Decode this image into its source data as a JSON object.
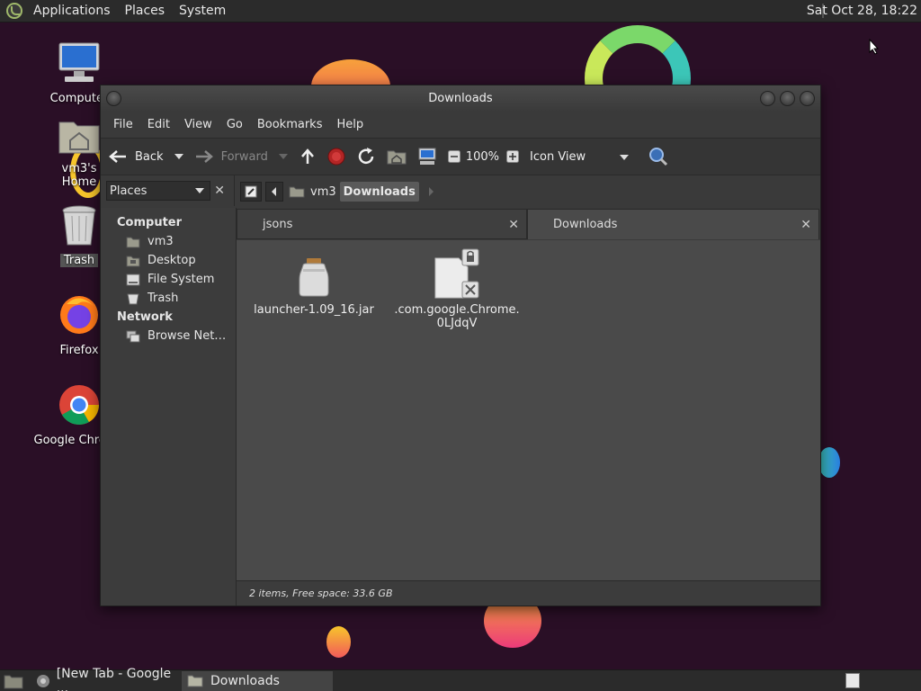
{
  "top_panel": {
    "menus": [
      "Applications",
      "Places",
      "System"
    ],
    "clock": "Sat Oct 28, 18:22"
  },
  "desktop_icons": [
    {
      "label": "Computer",
      "icon": "computer-icon"
    },
    {
      "label": "vm3's Home",
      "icon": "home-folder-icon"
    },
    {
      "label": "Trash",
      "icon": "trash-icon"
    },
    {
      "label": "Firefox",
      "icon": "firefox-icon"
    },
    {
      "label": "Google Chrome",
      "icon": "chrome-icon"
    }
  ],
  "window": {
    "title": "Downloads",
    "menu": [
      "File",
      "Edit",
      "View",
      "Go",
      "Bookmarks",
      "Help"
    ],
    "toolbar": {
      "back": "Back",
      "forward": "Forward",
      "zoom": "100%",
      "view_mode": "Icon View"
    },
    "places_label": "Places",
    "breadcrumb": [
      "vm3",
      "Downloads"
    ],
    "sidebar": {
      "computer_heading": "Computer",
      "computer_items": [
        "vm3",
        "Desktop",
        "File System",
        "Trash"
      ],
      "network_heading": "Network",
      "network_items": [
        "Browse Net…"
      ]
    },
    "tabs": [
      "jsons",
      "Downloads"
    ],
    "files": [
      {
        "name": "launcher-1.09_16.jar",
        "icon": "jar-icon"
      },
      {
        "name": ".com.google.Chrome.\n0LJdqV",
        "icon": "locked-file-icon"
      }
    ],
    "status": "2 items, Free space: 33.6 GB"
  },
  "taskbar": {
    "tasks": [
      "[New Tab - Google ...",
      "Downloads"
    ]
  },
  "colors": {
    "wallpaper": "#2a0f26",
    "panel": "#2b2b2b",
    "window_bg": "#3c3c3c"
  }
}
